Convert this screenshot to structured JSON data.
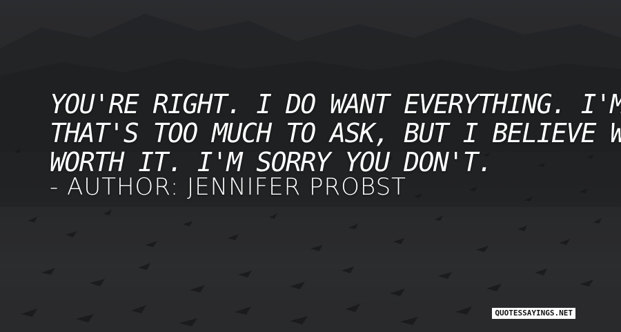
{
  "quote": {
    "lines": [
      "YOU'RE RIGHT. I DO WANT EVERYTHING. I'M SORRY",
      "THAT'S TOO MUCH TO ASK, BUT I BELIEVE WE'RE BOTH",
      "WORTH IT. I'M SORRY YOU DON'T."
    ]
  },
  "author_line": "- AUTHOR: JENNIFER PROBST",
  "watermark": "QUOTESSAYINGS.NET",
  "background": {
    "description": "dim photo of a flock of geese over water with hills behind",
    "colors": {
      "sky": "#3a3b3f",
      "hills": "#2f3033",
      "water": "#3b3c3e",
      "birds": "#1e1f21"
    }
  }
}
